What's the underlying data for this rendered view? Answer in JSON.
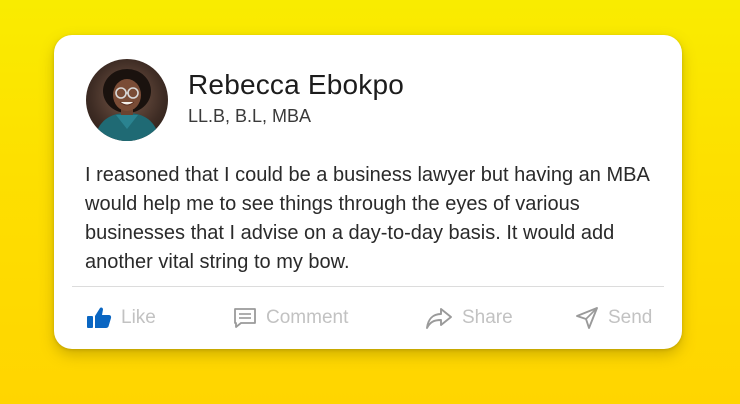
{
  "post": {
    "author_name": "Rebecca Ebokpo",
    "author_credentials": "LL.B, B.L, MBA",
    "text": "I reasoned that I could be a business lawyer but having an MBA would help me to see things through the eyes of various businesses that I advise on a day-to-day basis. It would add another vital string to my bow."
  },
  "actions": {
    "like": {
      "label": "Like",
      "icon": "thumbs-up-icon"
    },
    "comment": {
      "label": "Comment",
      "icon": "comment-icon"
    },
    "share": {
      "label": "Share",
      "icon": "share-arrow-icon"
    },
    "send": {
      "label": "Send",
      "icon": "send-icon"
    }
  },
  "colors": {
    "background": "#fde000",
    "card": "#ffffff",
    "like_accent": "#0a66c2",
    "action_label": "#c2c2c2"
  }
}
